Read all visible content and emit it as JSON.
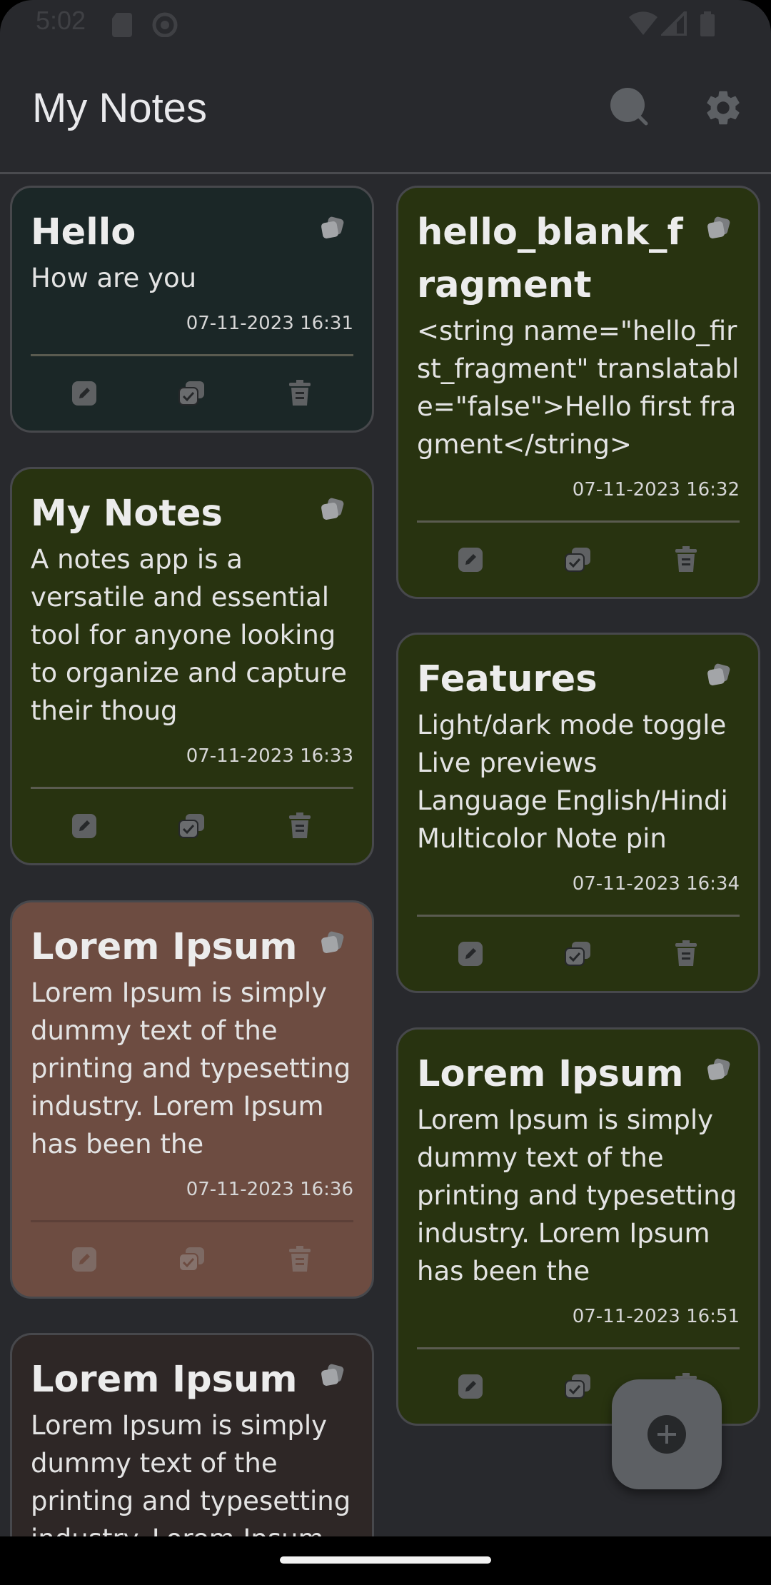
{
  "status_bar": {
    "time": "5:02"
  },
  "app_bar": {
    "title": "My Notes"
  },
  "colors": {
    "background": "#28292d",
    "note_teal": "#1b2727",
    "note_olive": "#283310",
    "note_brown": "#6d4c41",
    "note_dark_brown": "#2e2726",
    "fab": "#5d6064"
  },
  "notes": [
    {
      "title": "Hello",
      "body": "How are you",
      "date": "07-11-2023 16:31",
      "color": "teal"
    },
    {
      "title": "hello_blank_fragment",
      "body": " <string name=\"hello_first_fragment\" translatable=\"false\">Hello first fragment</string>",
      "date": "07-11-2023 16:32",
      "color": "olive"
    },
    {
      "title": "My Notes",
      "body": "A notes app is a versatile and essential tool for anyone looking to organize and capture their thoug",
      "date": "07-11-2023 16:33",
      "color": "olive"
    },
    {
      "title": "Features",
      "body_lines": [
        "Light/dark mode toggle",
        "Live previews",
        "Language English/Hindi",
        "Multicolor Note pin"
      ],
      "date": "07-11-2023 16:34",
      "color": "olive"
    },
    {
      "title": "Lorem Ipsum",
      "body": "Lorem Ipsum is simply dummy text of the printing and typesetting industry. Lorem Ipsum has been the",
      "date": "07-11-2023 16:36",
      "color": "brown"
    },
    {
      "title": "Lorem Ipsum",
      "body": "Lorem Ipsum is simply dummy text of the printing and typesetting industry. Lorem Ipsum has been the",
      "date": "07-11-2023 16:51",
      "color": "olive"
    },
    {
      "title": "Lorem Ipsum",
      "body": "Lorem Ipsum is simply dummy text of the printing and typesetting industry. Lorem Ipsum",
      "color": "dark_brown"
    }
  ],
  "icons": {
    "search": "search-icon",
    "settings": "gear-icon",
    "pin": "pin-icon",
    "edit": "edit-icon",
    "copy": "copy-icon",
    "delete": "delete-icon",
    "add": "add-icon"
  }
}
